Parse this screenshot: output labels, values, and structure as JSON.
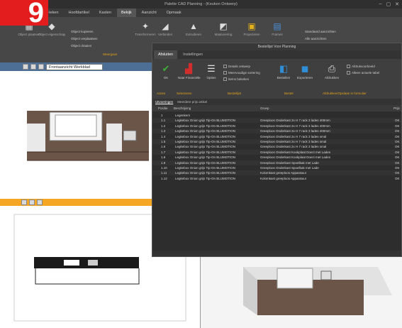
{
  "badge": {
    "number": "9"
  },
  "window": {
    "title": "Palette CAD Planning - (Keuken Ontwerp)",
    "min": "–",
    "max": "▢",
    "close": "✕"
  },
  "menu": {
    "tabs": [
      {
        "label": "Bestand",
        "active": false
      },
      {
        "label": "3D-teken",
        "active": false
      },
      {
        "label": "Hoofdartikel",
        "active": false
      },
      {
        "label": "Kasten",
        "active": false
      },
      {
        "label": "Bekijk",
        "active": true
      },
      {
        "label": "Aanzicht",
        "active": false
      },
      {
        "label": "Opmaak",
        "active": false
      }
    ]
  },
  "ribbon": {
    "buttons": [
      {
        "icon": "clipboard-icon",
        "glyph": "▦",
        "label": "Object plaatsen"
      },
      {
        "icon": "object-icon",
        "glyph": "◆",
        "label": "Object eigenschappen"
      },
      {
        "icon": "transform-icon",
        "glyph": "✦",
        "label": "Transformeren"
      },
      {
        "icon": "connect-icon",
        "glyph": "◢",
        "label": "Verbinden"
      },
      {
        "icon": "extrude-icon",
        "glyph": "▲",
        "label": "Extruderen"
      },
      {
        "icon": "measure-icon",
        "glyph": "◩",
        "label": "Maatvoering"
      },
      {
        "icon": "project-icon",
        "glyph": "▣",
        "label": "Projecteren"
      },
      {
        "icon": "frame-icon",
        "glyph": "▤",
        "label": "Frames"
      }
    ],
    "small_items": [
      "Object kopieren",
      "Object verplaatsen",
      "Object draaien",
      "Standaard aanzichten",
      "Alle aanzichten"
    ],
    "group_label": "Weergave"
  },
  "panes": {
    "front_view_select": "Frontaanzicht Werkblad"
  },
  "dialog": {
    "title": "Bestellijst Voor Planning",
    "tabs": [
      {
        "label": "Afsluiten",
        "active": true
      },
      {
        "label": "Instellingen",
        "active": false
      }
    ],
    "buttons": [
      {
        "name": "ok-button",
        "icon": "checkmark-icon",
        "glyph": "✔",
        "color": "#3fae3a",
        "label": "OK"
      },
      {
        "name": "pdf-button",
        "icon": "pdf-icon",
        "glyph": "▟",
        "color": "#d22d2d",
        "label": "Naar Financiële"
      },
      {
        "name": "options-button",
        "icon": "list-icon",
        "glyph": "☰",
        "color": "#e0e0e0",
        "label": "Opties"
      },
      {
        "name": "order-button",
        "icon": "order-icon",
        "glyph": "◧",
        "color": "#2f8ed6",
        "label": "Bestellen"
      },
      {
        "name": "export-button",
        "icon": "save-icon",
        "glyph": "◼",
        "color": "#2f8ed6",
        "label": "Exporteren"
      },
      {
        "name": "print-button",
        "icon": "printer-icon",
        "glyph": "⎙",
        "color": "#e0e0e0",
        "label": "Afdrukken"
      }
    ],
    "options": [
      "Details ontwerp",
      "Meervoudige sortering",
      "Items bekeken",
      "Afdrukvoorbeeld",
      "Alleen actuele tabel"
    ],
    "groups": [
      "Acties",
      "Selecteren",
      "Bestellijst",
      "Bestel",
      "Afdrukken/Opslaan in formulier"
    ],
    "subtabs": [
      {
        "label": "Uitvoeringen",
        "active": true
      },
      {
        "label": "Meerdere prijs artikel",
        "active": false
      }
    ],
    "columns": [
      "Positie",
      "Beschrijving",
      "Groep",
      "Prijs"
    ],
    "rows": [
      {
        "pos": "1",
        "desc": "Legenkern",
        "group": "",
        "price": ""
      },
      {
        "pos": "1.1",
        "desc": "Legkebox Onion grijs Tip-On BLUMOTION",
        "group": "Greeploos Onderkast 2x H 7 rack 3 lades 400mm",
        "price": "OK"
      },
      {
        "pos": "1.2",
        "desc": "Legkebox Onion grijs Tip-On BLUMOTION",
        "group": "Greeploos Onderkast 2x H 7 rack 3 lades 400mm",
        "price": "OK"
      },
      {
        "pos": "1.3",
        "desc": "Legkebox Onion grijs Tip-On BLUMOTION",
        "group": "Greeploos Onderkast 2x H 7 rack 3 lades 400mm",
        "price": "OK"
      },
      {
        "pos": "1.4",
        "desc": "Legkebox Onion grijs Tip-On BLUMOTION",
        "group": "Greeploos Onderkast 2x H 7 rack 3 lades smal",
        "price": "OK"
      },
      {
        "pos": "1.5",
        "desc": "Legkebox Onion grijs Tip-On BLUMOTION",
        "group": "Greeploos Onderkast 2x H 7 rack 3 lades smal",
        "price": "OK"
      },
      {
        "pos": "1.6",
        "desc": "Legkebox Onion grijs Tip-On BLUMOTION",
        "group": "Greeploos Onderkast 2x H 7 rack 3 lades smal",
        "price": "OK"
      },
      {
        "pos": "1.7",
        "desc": "Legkebox Onion grijs Tip-On BLUMOTION",
        "group": "Greeploos Onderkast Kookplaat Doezi met Lades",
        "price": "OK"
      },
      {
        "pos": "1.8",
        "desc": "Legkebox Onion grijs Tip-On BLUMOTION",
        "group": "Greeploos Onderkast Kookplaat Doezi met Lades",
        "price": "OK"
      },
      {
        "pos": "1.9",
        "desc": "Legkebox Onion grijs Tip-On BLUMOTION",
        "group": "Greeploos Onderkast Spoelbak met Lade",
        "price": "OK"
      },
      {
        "pos": "1.10",
        "desc": "Legkebox Onion grijs Tip-On BLUMOTION",
        "group": "Greeploos Onderkast Spoelbak met Lade",
        "price": "OK"
      },
      {
        "pos": "1.11",
        "desc": "Legkebox Onion grijs Tip-On BLUMOTION",
        "group": "Kolomkast greeploos Apparatuur",
        "price": "OK"
      },
      {
        "pos": "1.12",
        "desc": "Legkebox Onion grijs Tip-On BLUMOTION",
        "group": "Kolomkast greeploos Apparatuur",
        "price": "OK"
      }
    ]
  }
}
